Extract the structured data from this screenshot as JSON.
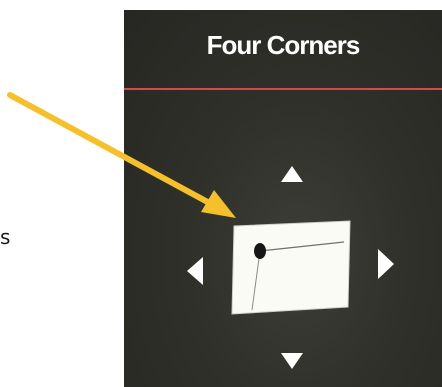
{
  "panel": {
    "title": "Four Corners"
  },
  "side_label": "s",
  "icons": {
    "up": "triangle-up-icon",
    "down": "triangle-down-icon",
    "left": "triangle-left-icon",
    "right": "triangle-right-icon",
    "pointer": "yellow-arrow-icon"
  },
  "colors": {
    "panel_bg": "#30302b",
    "divider": "#d24a4a",
    "arrow": "#f5c02a",
    "icon": "#ffffff"
  }
}
